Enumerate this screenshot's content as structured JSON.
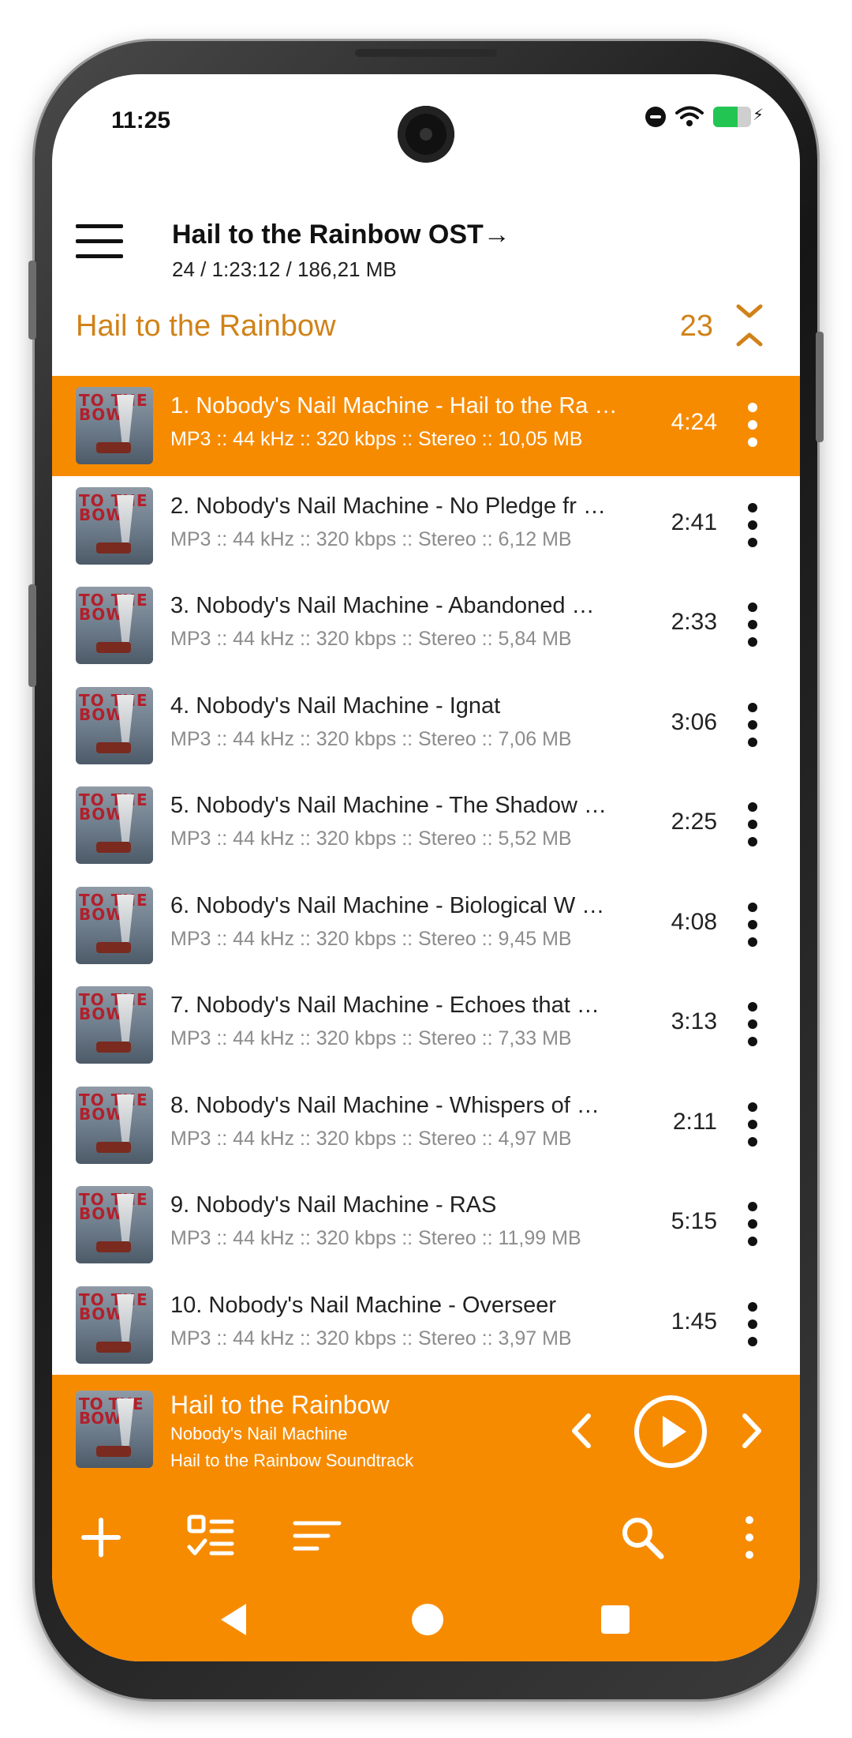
{
  "status_bar": {
    "time": "11:25"
  },
  "header": {
    "title": "Hail to the Rainbow OST→",
    "subtitle": "24 / 1:23:12 / 186,21 MB"
  },
  "playlist": {
    "name": "Hail to the Rainbow",
    "count": "23"
  },
  "album_art_text": "TO THE BOW",
  "tracks": [
    {
      "title": "1. Nobody's Nail Machine - Hail to the Ra …",
      "meta": "MP3 :: 44 kHz :: 320 kbps :: Stereo :: 10,05 MB",
      "duration": "4:24",
      "active": true
    },
    {
      "title": "2. Nobody's Nail Machine - No Pledge fr  …",
      "meta": "MP3 :: 44 kHz :: 320 kbps :: Stereo :: 6,12 MB",
      "duration": "2:41"
    },
    {
      "title": "3. Nobody's Nail Machine - Abandoned   …",
      "meta": "MP3 :: 44 kHz :: 320 kbps :: Stereo :: 5,84 MB",
      "duration": "2:33"
    },
    {
      "title": "4. Nobody's Nail Machine - Ignat",
      "meta": "MP3 :: 44 kHz :: 320 kbps :: Stereo :: 7,06 MB",
      "duration": "3:06"
    },
    {
      "title": "5. Nobody's Nail Machine - The Shadow …",
      "meta": "MP3 :: 44 kHz :: 320 kbps :: Stereo :: 5,52 MB",
      "duration": "2:25"
    },
    {
      "title": "6. Nobody's Nail Machine - Biological W …",
      "meta": "MP3 :: 44 kHz :: 320 kbps :: Stereo :: 9,45 MB",
      "duration": "4:08"
    },
    {
      "title": "7. Nobody's Nail Machine - Echoes that   …",
      "meta": "MP3 :: 44 kHz :: 320 kbps :: Stereo :: 7,33 MB",
      "duration": "3:13"
    },
    {
      "title": "8. Nobody's Nail Machine - Whispers of …",
      "meta": "MP3 :: 44 kHz :: 320 kbps :: Stereo :: 4,97 MB",
      "duration": "2:11"
    },
    {
      "title": "9. Nobody's Nail Machine - RAS",
      "meta": "MP3 :: 44 kHz :: 320 kbps :: Stereo :: 11,99 MB",
      "duration": "5:15"
    },
    {
      "title": "10. Nobody's Nail Machine - Overseer",
      "meta": "MP3 :: 44 kHz :: 320 kbps :: Stereo :: 3,97 MB",
      "duration": "1:45"
    }
  ],
  "now_playing": {
    "title": "Hail to the Rainbow",
    "artist": "Nobody's Nail Machine",
    "album": "Hail to the Rainbow Soundtrack"
  },
  "icons": {
    "menu": "hamburger-menu-icon",
    "collapse": "collapse-expand-icon",
    "more": "more-vert-icon",
    "prev": "chevron-left-icon",
    "play": "play-circle-icon",
    "next": "chevron-right-icon",
    "add": "plus-icon",
    "select": "checklist-icon",
    "sort": "sort-icon",
    "search": "search-icon"
  },
  "colors": {
    "accent": "#f78b00",
    "playlist_text": "#d08219",
    "meta_text": "#8c8c8c"
  }
}
